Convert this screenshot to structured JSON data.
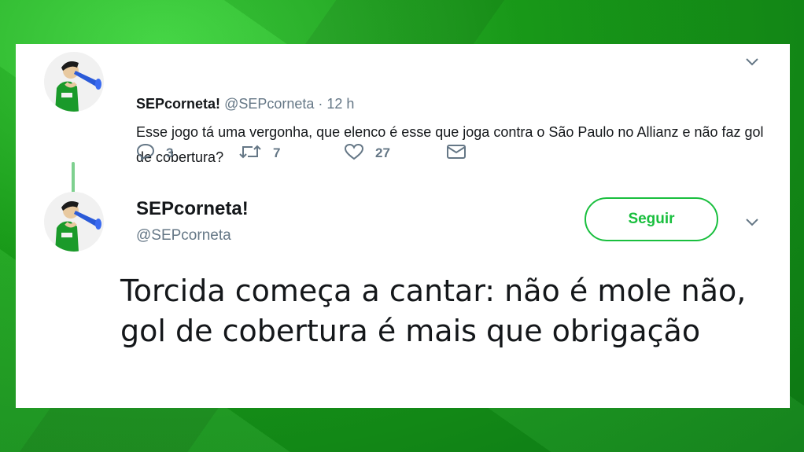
{
  "tweet1": {
    "name": "SEPcorneta!",
    "handle": "@SEPcorneta",
    "time": "· 12 h",
    "text": "Esse jogo tá uma vergonha, que elenco é esse que joga contra o São Paulo no Allianz e não faz gol de cobertura?",
    "actions": {
      "replies": "3",
      "retweets": "7",
      "likes": "27"
    }
  },
  "tweet2": {
    "name": "SEPcorneta!",
    "handle": "@SEPcorneta",
    "follow_label": "Seguir",
    "text": "Torcida começa a cantar: não é mole não, gol de cobertura é mais que obrigação"
  },
  "colors": {
    "background": "#1fa81f",
    "accent": "#19bf3e",
    "thread_line": "#7ed08f"
  },
  "icons": [
    "avatar",
    "chevron-down-icon",
    "reply-icon",
    "retweet-icon",
    "like-icon",
    "message-icon"
  ]
}
